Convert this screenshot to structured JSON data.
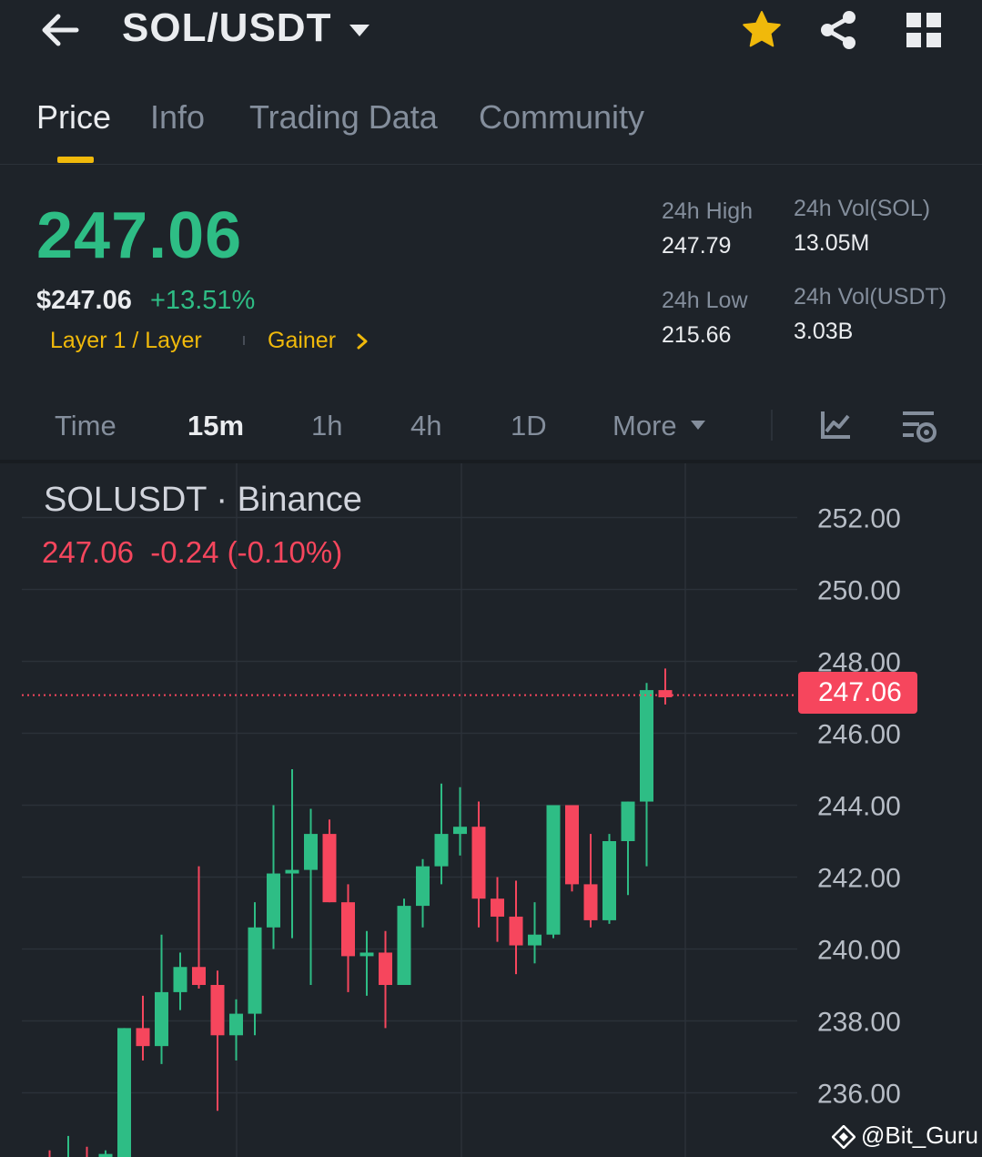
{
  "header": {
    "pair": "SOL/USDT",
    "icons": [
      "back-arrow-icon",
      "caret-down-icon",
      "star-icon",
      "share-icon",
      "grid-icon"
    ],
    "star_color": "#f0b90b"
  },
  "tabs": [
    {
      "label": "Price",
      "active": true
    },
    {
      "label": "Info",
      "active": false
    },
    {
      "label": "Trading Data",
      "active": false
    },
    {
      "label": "Community",
      "active": false
    }
  ],
  "summary": {
    "last_price": "247.06",
    "usd_price": "$247.06",
    "change_pct": "+13.51%",
    "tag_category": "Layer 1 / Layer",
    "tag_list": "Gainer",
    "high_label": "24h High",
    "high_value": "247.79",
    "low_label": "24h Low",
    "low_value": "215.66",
    "vol_base_label": "24h Vol(SOL)",
    "vol_base_value": "13.05M",
    "vol_quote_label": "24h Vol(USDT)",
    "vol_quote_value": "3.03B"
  },
  "timeframes": {
    "items": [
      "Time",
      "15m",
      "1h",
      "4h",
      "1D",
      "More"
    ],
    "selected": "15m"
  },
  "chart_header": {
    "title": "SOLUSDT · Binance",
    "ohlc": "247.06  -0.24 (-0.10%)"
  },
  "chart_data": {
    "type": "candlestick",
    "interval": "15m",
    "current_price": 247.06,
    "current_price_label": "247.06",
    "ylim": [
      234,
      253.2
    ],
    "y_ticks": [
      236,
      238,
      240,
      242,
      244,
      246,
      248,
      250,
      252
    ],
    "y_tick_labels": [
      "236.00",
      "238.00",
      "240.00",
      "242.00",
      "244.00",
      "246.00",
      "248.00",
      "250.00",
      "252.00"
    ],
    "up_color": "#2ebd85",
    "down_color": "#f6465d",
    "candles": [
      {
        "o": 234.0,
        "h": 234.4,
        "l": 233.6,
        "c": 233.9
      },
      {
        "o": 233.9,
        "h": 234.8,
        "l": 233.5,
        "c": 234.1
      },
      {
        "o": 234.1,
        "h": 234.5,
        "l": 233.6,
        "c": 233.8
      },
      {
        "o": 233.8,
        "h": 234.4,
        "l": 233.4,
        "c": 234.3
      },
      {
        "o": 234.2,
        "h": 237.8,
        "l": 234.1,
        "c": 237.8
      },
      {
        "o": 237.8,
        "h": 238.7,
        "l": 236.9,
        "c": 237.3
      },
      {
        "o": 237.3,
        "h": 240.4,
        "l": 236.8,
        "c": 238.8
      },
      {
        "o": 238.8,
        "h": 239.9,
        "l": 238.3,
        "c": 239.5
      },
      {
        "o": 239.5,
        "h": 242.3,
        "l": 238.9,
        "c": 239.0
      },
      {
        "o": 239.0,
        "h": 239.4,
        "l": 235.5,
        "c": 237.6
      },
      {
        "o": 237.6,
        "h": 238.6,
        "l": 236.9,
        "c": 238.2
      },
      {
        "o": 238.2,
        "h": 241.3,
        "l": 237.6,
        "c": 240.6
      },
      {
        "o": 240.6,
        "h": 244.0,
        "l": 240.0,
        "c": 242.1
      },
      {
        "o": 242.1,
        "h": 245.0,
        "l": 240.3,
        "c": 242.2
      },
      {
        "o": 242.2,
        "h": 243.9,
        "l": 239.0,
        "c": 243.2
      },
      {
        "o": 243.2,
        "h": 243.6,
        "l": 241.3,
        "c": 241.3
      },
      {
        "o": 241.3,
        "h": 241.8,
        "l": 238.8,
        "c": 239.8
      },
      {
        "o": 239.8,
        "h": 240.5,
        "l": 238.7,
        "c": 239.9
      },
      {
        "o": 239.9,
        "h": 240.5,
        "l": 237.8,
        "c": 239.0
      },
      {
        "o": 239.0,
        "h": 241.4,
        "l": 239.0,
        "c": 241.2
      },
      {
        "o": 241.2,
        "h": 242.5,
        "l": 240.6,
        "c": 242.3
      },
      {
        "o": 242.3,
        "h": 244.6,
        "l": 241.8,
        "c": 243.2
      },
      {
        "o": 243.2,
        "h": 244.5,
        "l": 242.6,
        "c": 243.4
      },
      {
        "o": 243.4,
        "h": 244.1,
        "l": 240.6,
        "c": 241.4
      },
      {
        "o": 241.4,
        "h": 242.0,
        "l": 240.2,
        "c": 240.9
      },
      {
        "o": 240.9,
        "h": 241.9,
        "l": 239.3,
        "c": 240.1
      },
      {
        "o": 240.1,
        "h": 241.3,
        "l": 239.6,
        "c": 240.4
      },
      {
        "o": 240.4,
        "h": 244.0,
        "l": 240.3,
        "c": 244.0
      },
      {
        "o": 244.0,
        "h": 243.9,
        "l": 241.6,
        "c": 241.8
      },
      {
        "o": 241.8,
        "h": 243.2,
        "l": 240.6,
        "c": 240.8
      },
      {
        "o": 240.8,
        "h": 243.2,
        "l": 240.7,
        "c": 243.0
      },
      {
        "o": 243.0,
        "h": 244.1,
        "l": 241.5,
        "c": 244.1
      },
      {
        "o": 244.1,
        "h": 247.4,
        "l": 242.3,
        "c": 247.2
      },
      {
        "o": 247.2,
        "h": 247.8,
        "l": 246.8,
        "c": 247.0
      }
    ]
  },
  "watermark": "@Bit_Guru"
}
